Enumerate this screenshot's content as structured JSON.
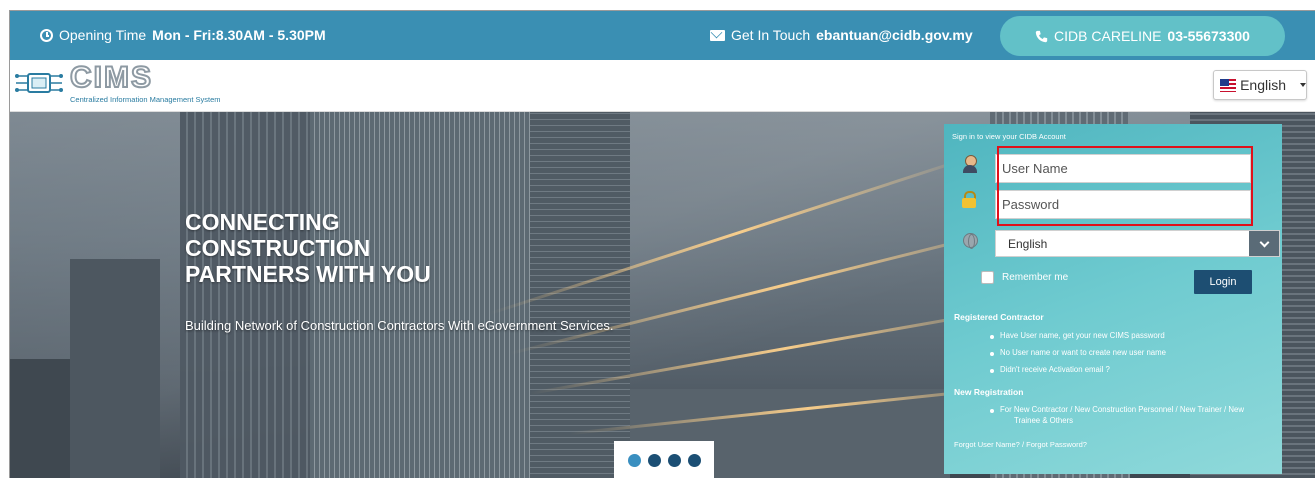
{
  "topbar": {
    "opening_label": "Opening Time",
    "opening_value": "Mon - Fri:8.30AM - 5.30PM",
    "touch_label": "Get In Touch",
    "touch_value": "ebantuan@cidb.gov.my",
    "careline_label": "CIDB CARELINE",
    "careline_value": "03-55673300"
  },
  "header": {
    "logo_word": "CIMS",
    "logo_sub": "Centralized Information Management System",
    "language_selected": "English"
  },
  "hero": {
    "headline_line1": "CONNECTING",
    "headline_line2": "CONSTRUCTION",
    "headline_line3": "PARTNERS WITH YOU",
    "tagline": "Building Network of Construction Contractors With eGovernment Services.",
    "slide_count": 4,
    "active_slide": 1
  },
  "login": {
    "caption": "Sign in to view your CIDB Account",
    "username_placeholder": "User Name",
    "password_placeholder": "Password",
    "language_value": "English",
    "remember_label": "Remember me",
    "login_label": "Login",
    "registered_title": "Registered Contractor",
    "registered_links": [
      "Have User name, get your new CIMS password",
      "No User name or want to create new user name",
      "Didn't receive Activation email ?"
    ],
    "new_reg_title": "New Registration",
    "new_reg_line1": "For New Contractor / New Construction Personnel / New Trainer / New",
    "new_reg_line2": "Trainee & Others",
    "forgot_text": "Forgot User Name? / Forgot Password?"
  },
  "colors": {
    "topbar": "#3a8fb3",
    "careline_pill": "#62c1c8",
    "login_button": "#1d4e72",
    "highlight": "#e0101a"
  }
}
